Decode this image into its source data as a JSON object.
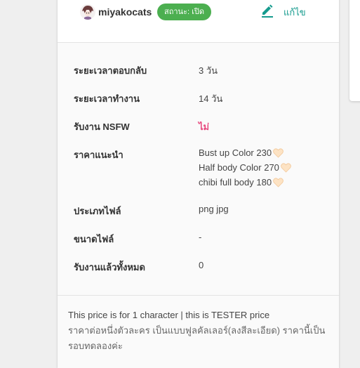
{
  "profile": {
    "username": "miyakocats",
    "status": "สถานะ: เปิด",
    "edit_label": "แก้ไข"
  },
  "details": {
    "response_time": {
      "label": "ระยะเวลาตอบกลับ",
      "value": "3 วัน"
    },
    "work_time": {
      "label": "ระยะเวลาทำงาน",
      "value": "14 วัน"
    },
    "nsfw": {
      "label": "รับงาน NSFW",
      "value": "ไม่"
    },
    "price": {
      "label": "ราคาแนะนำ",
      "items": [
        "Bust up Color 230",
        "Half body Color 270",
        "chibi full body  180"
      ]
    },
    "file_type": {
      "label": "ประเภทไฟล์",
      "value": "png jpg"
    },
    "file_size": {
      "label": "ขนาดไฟล์",
      "value": "-"
    },
    "total_jobs": {
      "label": "รับงานแล้วทั้งหมด",
      "value": "0"
    }
  },
  "note": {
    "en": "This price is for 1 character  | this is TESTER price",
    "th": "ราคาต่อหนึ่งตัวละคร เป็นแบบฟูลคัลเลอร์(ลงสีละเอียด) ราคานี้เป็นรอบทดลองค่ะ"
  },
  "colors": {
    "status_green": "#4caf50",
    "accent_teal": "#169b8e",
    "nsfw_pink": "#e84a7f"
  },
  "icons": [
    "avatar",
    "pencil-icon",
    "heart-icon"
  ]
}
